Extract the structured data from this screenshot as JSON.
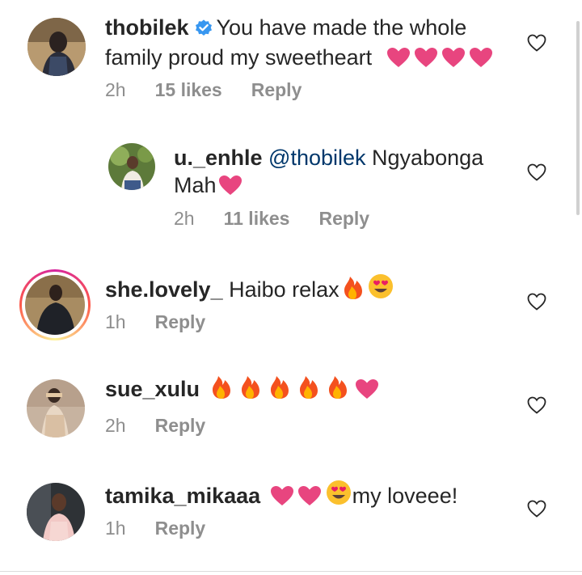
{
  "comments": [
    {
      "username": "thobilek",
      "verified": true,
      "mention": "",
      "text": "You have made the whole family proud my sweetheart",
      "emojis": [
        "heart",
        "heart",
        "heart",
        "heart"
      ],
      "time": "2h",
      "likes": "15 likes",
      "reply": "Reply"
    },
    {
      "username": "u._enhle",
      "verified": false,
      "mention": "@thobilek",
      "text": "Ngyabonga Mah",
      "emojis": [
        "heart"
      ],
      "time": "2h",
      "likes": "11 likes",
      "reply": "Reply"
    },
    {
      "username": "she.lovely_",
      "verified": false,
      "mention": "",
      "text": "Haibo relax",
      "emojis": [
        "fire",
        "heart-eyes"
      ],
      "time": "1h",
      "likes": "",
      "reply": "Reply"
    },
    {
      "username": "sue_xulu",
      "verified": false,
      "mention": "",
      "text": "",
      "emojis": [
        "fire",
        "fire",
        "fire",
        "fire",
        "fire",
        "heart"
      ],
      "time": "2h",
      "likes": "",
      "reply": "Reply"
    },
    {
      "username": "tamika_mikaaa",
      "verified": false,
      "mention": "",
      "text": "my loveee!",
      "emojis": [
        "heart",
        "heart",
        "heart-eyes"
      ],
      "time": "1h",
      "likes": "",
      "reply": "Reply"
    }
  ],
  "icons": {
    "like": "heart-outline-icon",
    "verified": "verified-badge-icon"
  },
  "colors": {
    "heart": "#e8457f",
    "verified": "#3897f0",
    "muted": "#8e8e8e",
    "mention": "#00376b"
  }
}
